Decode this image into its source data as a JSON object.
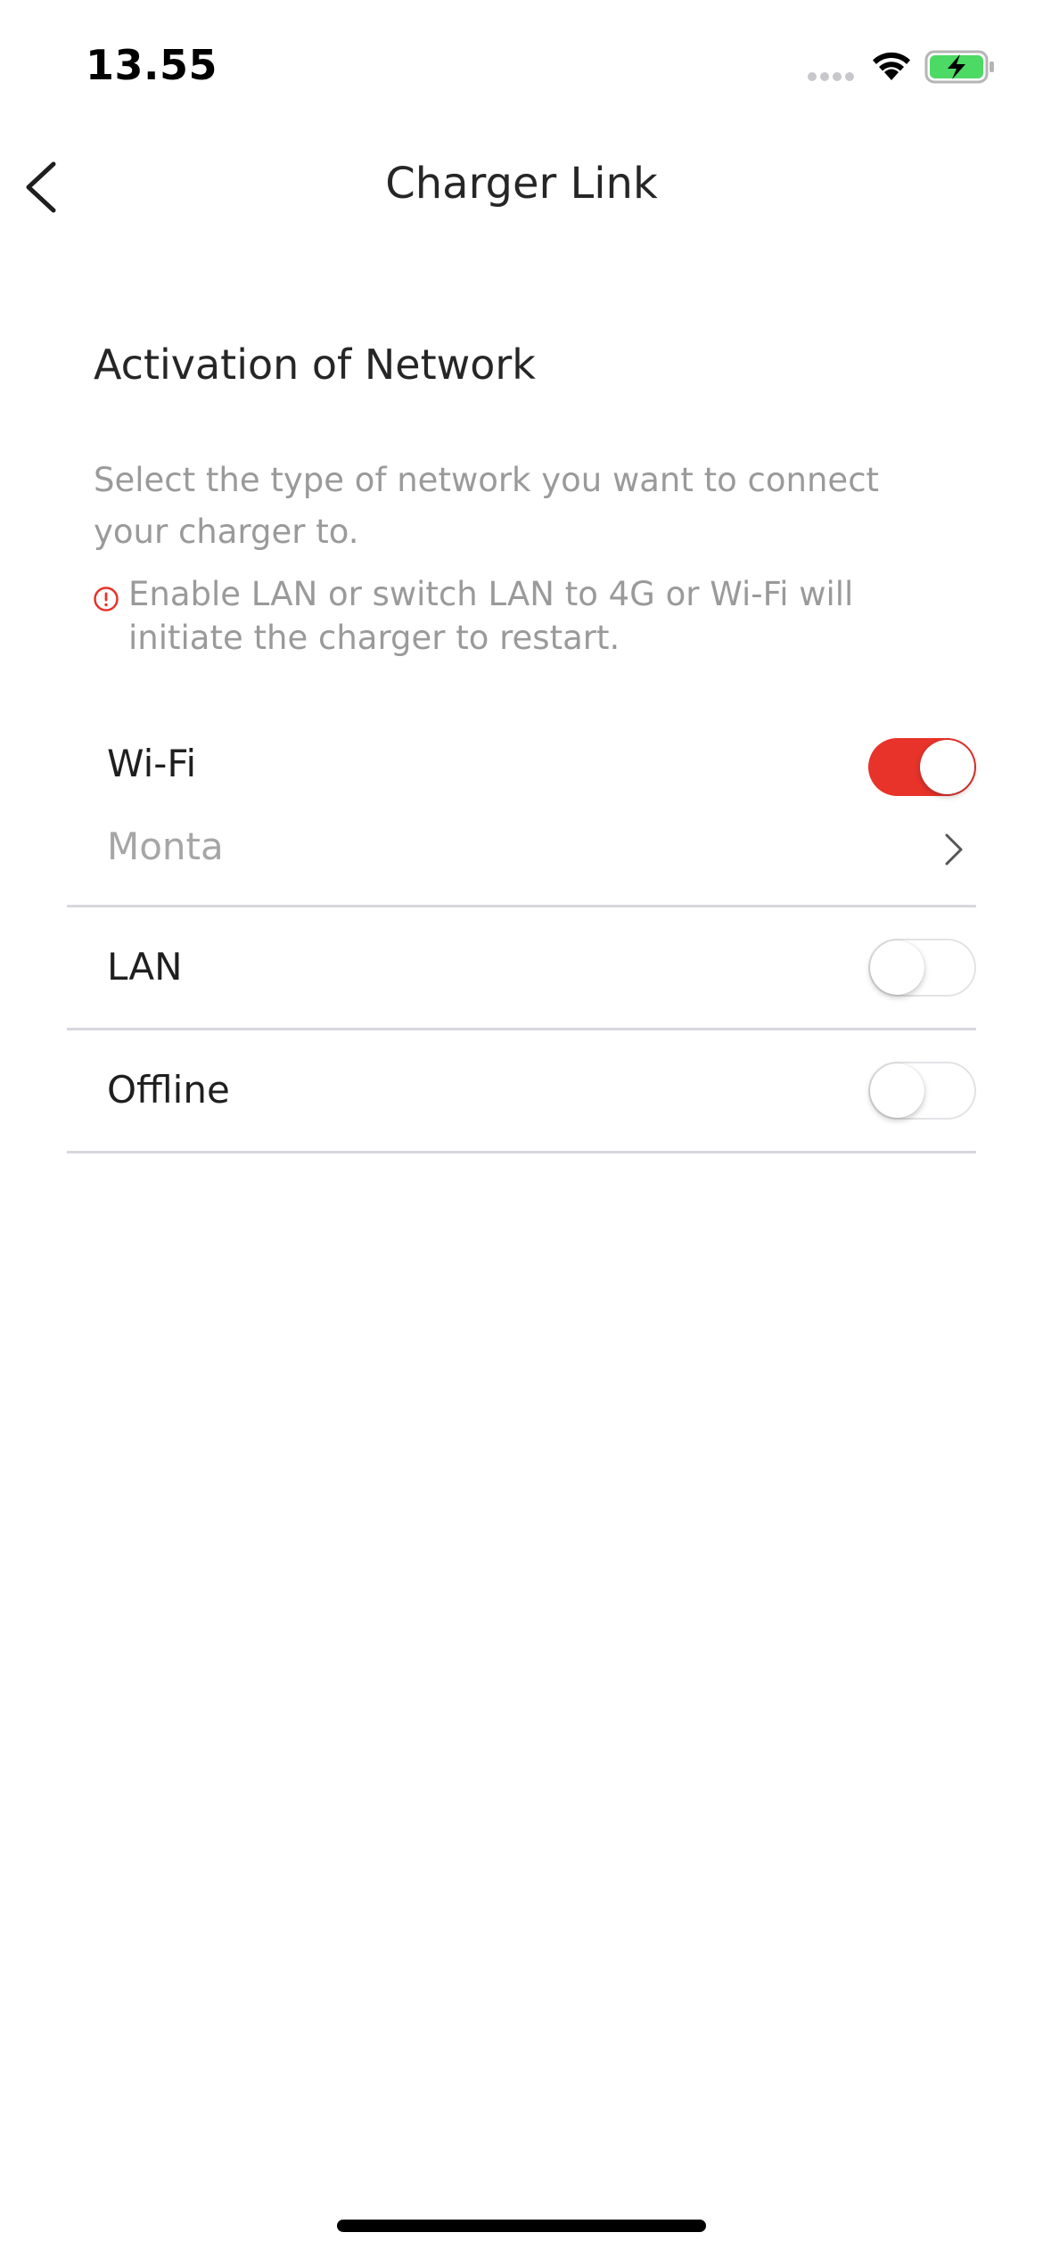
{
  "status_bar": {
    "time": "13.55",
    "icons": [
      "cellular-signal-icon",
      "wifi-icon",
      "battery-charging-icon"
    ],
    "battery_color": "#4cd964"
  },
  "nav": {
    "title": "Charger Link",
    "back_icon": "chevron-left-icon"
  },
  "section": {
    "title": "Activation of Network",
    "description": "Select the type of network you want to connect your charger to.",
    "warning": {
      "icon": "alert-circle-icon",
      "text": "Enable LAN or switch LAN to 4G or Wi-Fi will initiate the charger to restart.",
      "icon_color": "#e8332a"
    }
  },
  "networks": [
    {
      "label": "Wi-Fi",
      "enabled": true,
      "selected_network": "Monta"
    },
    {
      "label": "LAN",
      "enabled": false
    },
    {
      "label": "Offline",
      "enabled": false
    }
  ],
  "colors": {
    "accent": "#e8332a",
    "divider": "#d7d7de",
    "secondary_text": "#9a9a9a"
  }
}
